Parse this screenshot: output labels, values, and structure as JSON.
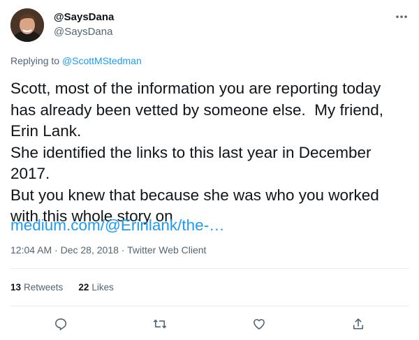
{
  "author": {
    "display_name": "@SaysDana",
    "handle": "@SaysDana",
    "avatar_icon": "user-avatar"
  },
  "reply": {
    "prefix": "Replying to ",
    "to": "@ScottMStedman"
  },
  "tweet": {
    "text": "Scott, most of the information you are reporting today\nhas already been vetted by someone else.  My friend,\nErin Lank.\nShe identified the links to this last year in December\n2017.\nBut you knew that because she was who you worked\nwith this whole story on",
    "link": "medium.com/@Erinlank/the-…"
  },
  "meta": {
    "time": "12:04 AM",
    "separator1": " · ",
    "date": "Dec 28, 2018",
    "separator2": " · ",
    "client": "Twitter Web Client"
  },
  "stats": {
    "retweets_count": "13",
    "retweets_label": "Retweets",
    "likes_count": "22",
    "likes_label": "Likes"
  },
  "actions": {
    "reply_icon": "reply-icon",
    "retweet_icon": "retweet-icon",
    "like_icon": "like-icon",
    "share_icon": "share-icon"
  },
  "colors": {
    "text": "#0f1419",
    "secondary": "#536471",
    "link": "#1d9bf0",
    "divider": "#e6ecf0"
  }
}
